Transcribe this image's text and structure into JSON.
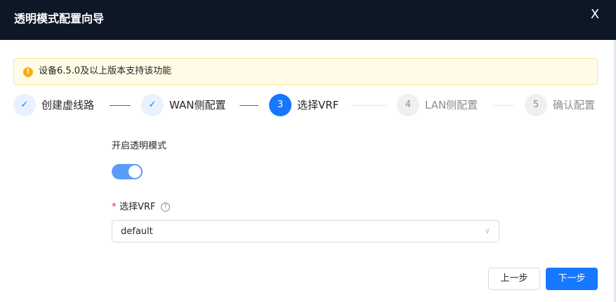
{
  "dialog": {
    "title": "透明模式配置向导",
    "close_glyph": "X"
  },
  "alert": {
    "icon_glyph": "!",
    "message": "设备6.5.0及以上版本支持该功能"
  },
  "steps": [
    {
      "glyph": "✓",
      "label": "创建虚线路",
      "status": "done"
    },
    {
      "glyph": "✓",
      "label": "WAN侧配置",
      "status": "done"
    },
    {
      "glyph": "3",
      "label": "选择VRF",
      "status": "active"
    },
    {
      "glyph": "4",
      "label": "LAN侧配置",
      "status": "wait"
    },
    {
      "glyph": "5",
      "label": "确认配置",
      "status": "wait"
    }
  ],
  "form": {
    "transparent_mode_label": "开启透明模式",
    "transparent_mode_on": true,
    "required_mark": "*",
    "vrf_label": "选择VRF",
    "help_glyph": "?",
    "vrf_value": "default",
    "dropdown_glyph": "∨"
  },
  "footer": {
    "prev_label": "上一步",
    "next_label": "下一步"
  },
  "colors": {
    "header_bg": "#0e1726",
    "primary": "#1677ff",
    "warning": "#faad14",
    "switch_on": "#5b9cf8"
  }
}
